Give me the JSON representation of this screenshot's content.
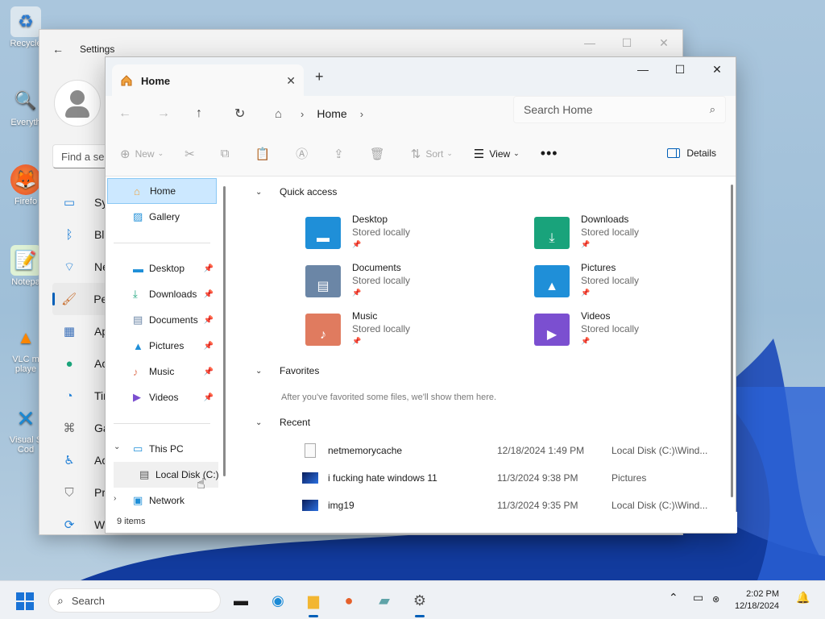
{
  "desktop": {
    "icons": [
      {
        "label": "Recycle",
        "icon": "recycle-bin-icon"
      },
      {
        "label": "Everyth",
        "icon": "everything-search-icon"
      },
      {
        "label": "Firefo",
        "icon": "firefox-icon"
      },
      {
        "label": "Notepa",
        "icon": "notepad-icon"
      },
      {
        "label": "VLC m\nplaye",
        "icon": "vlc-icon"
      },
      {
        "label": "Visual S\nCod",
        "icon": "vscode-icon"
      }
    ]
  },
  "settings": {
    "title": "Settings",
    "find_placeholder": "Find a se",
    "nav": [
      {
        "label": "Syst",
        "icon": "monitor-icon"
      },
      {
        "label": "Blue",
        "icon": "bluetooth-icon"
      },
      {
        "label": "Net",
        "icon": "wifi-icon"
      },
      {
        "label": "Pers",
        "icon": "paintbrush-icon",
        "active": true
      },
      {
        "label": "App",
        "icon": "apps-icon"
      },
      {
        "label": "Acc",
        "icon": "accounts-icon"
      },
      {
        "label": "Tim",
        "icon": "globe-clock-icon"
      },
      {
        "label": "Gan",
        "icon": "gamepad-icon"
      },
      {
        "label": "Acc",
        "icon": "accessibility-icon"
      },
      {
        "label": "Priv",
        "icon": "shield-icon"
      },
      {
        "label": "Win",
        "icon": "update-icon"
      }
    ]
  },
  "explorer": {
    "tab_title": "Home",
    "address": {
      "crumb": "Home"
    },
    "search_placeholder": "Search Home",
    "toolbar": {
      "new": "New",
      "sort": "Sort",
      "view": "View",
      "details": "Details"
    },
    "nav_pane": {
      "top": [
        {
          "label": "Home",
          "icon": "home-icon",
          "selected": true
        },
        {
          "label": "Gallery",
          "icon": "gallery-icon"
        }
      ],
      "pinned": [
        {
          "label": "Desktop",
          "icon": "desktop-folder-icon"
        },
        {
          "label": "Downloads",
          "icon": "downloads-icon"
        },
        {
          "label": "Documents",
          "icon": "documents-icon"
        },
        {
          "label": "Pictures",
          "icon": "pictures-icon"
        },
        {
          "label": "Music",
          "icon": "music-icon"
        },
        {
          "label": "Videos",
          "icon": "videos-icon"
        }
      ],
      "this_pc": "This PC",
      "local_disk": "Local Disk (C:)",
      "network": "Network"
    },
    "quick_access": {
      "heading": "Quick access",
      "items": [
        {
          "name": "Desktop",
          "status": "Stored locally",
          "color": "#1f8fd8",
          "icon": "desktop-folder-icon"
        },
        {
          "name": "Downloads",
          "status": "Stored locally",
          "color": "#19a37b",
          "icon": "downloads-icon"
        },
        {
          "name": "Documents",
          "status": "Stored locally",
          "color": "#6b86a6",
          "icon": "documents-icon"
        },
        {
          "name": "Pictures",
          "status": "Stored locally",
          "color": "#1f8fd8",
          "icon": "pictures-icon"
        },
        {
          "name": "Music",
          "status": "Stored locally",
          "color": "#e07b5f",
          "icon": "music-icon"
        },
        {
          "name": "Videos",
          "status": "Stored locally",
          "color": "#7b4fd0",
          "icon": "videos-icon"
        }
      ]
    },
    "favorites": {
      "heading": "Favorites",
      "empty_text": "After you've favorited some files, we'll show them here."
    },
    "recent": {
      "heading": "Recent",
      "rows": [
        {
          "name": "netmemorycache",
          "date": "12/18/2024 1:49 PM",
          "location": "Local Disk (C:)\\Wind...",
          "icon": "file-icon"
        },
        {
          "name": "i fucking hate windows 11",
          "date": "11/3/2024 9:38 PM",
          "location": "Pictures",
          "icon": "image-icon"
        },
        {
          "name": "img19",
          "date": "11/3/2024 9:35 PM",
          "location": "Local Disk (C:)\\Wind...",
          "icon": "image-icon"
        }
      ]
    },
    "status": "9 items"
  },
  "taskbar": {
    "search": "Search",
    "time": "2:02 PM",
    "date": "12/18/2024"
  }
}
